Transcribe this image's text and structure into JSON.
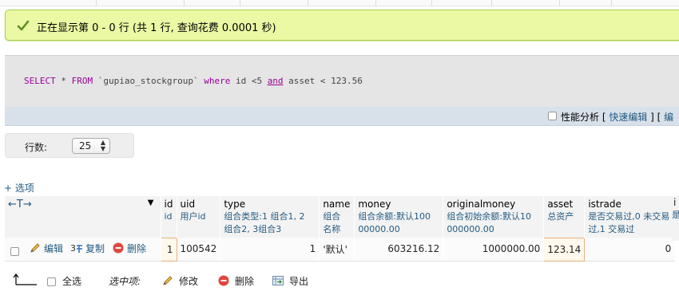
{
  "success": {
    "message": "正在显示第 0 - 0 行 (共 1 行, 查询花费 0.0001 秒)"
  },
  "sql": {
    "select": "SELECT",
    "star": " * ",
    "from": "FROM",
    "table": " `gupiao_stockgroup` ",
    "where": "where",
    "cond1": " id <5 ",
    "and": "and",
    "cond2": " asset < ",
    "value": "123.56"
  },
  "toolbar": {
    "profiling": "性能分析",
    "bracket_open": "[ ",
    "inline_edit": "快速编辑",
    "separator": " ] [ ",
    "edit_cut": "编"
  },
  "rows_control": {
    "label": "行数:",
    "value": "25"
  },
  "options_link": "+ 选项",
  "table": {
    "arrows": "←T→",
    "columns": [
      {
        "name": "id",
        "comment": "id"
      },
      {
        "name": "uid",
        "comment": "用户id"
      },
      {
        "name": "type",
        "comment": "组合类型:1 组合1, 2 组合2, 3组合3"
      },
      {
        "name": "name",
        "comment": "组合名称"
      },
      {
        "name": "money",
        "comment": "组合余额:默认10000000.00"
      },
      {
        "name": "originalmoney",
        "comment": "组合初始余额:默认10000000.00"
      },
      {
        "name": "asset",
        "comment": "总资产"
      },
      {
        "name": "istrade",
        "comment": "是否交易过,0 未交易过,1 交易过"
      },
      {
        "name": "i",
        "comment": "是"
      }
    ],
    "row_actions": {
      "edit": "编辑",
      "copy": "复制",
      "delete": "删除"
    },
    "rows": [
      {
        "id": "1",
        "uid": "100542",
        "type": "1",
        "name": "'默认'",
        "money": "603216.12",
        "originalmoney": "1000000.00",
        "asset": "123.14",
        "istrade": "0"
      }
    ]
  },
  "footer": {
    "select_all": "全选",
    "selected_label": "选中项:",
    "edit": "修改",
    "delete": "删除",
    "export": "导出"
  }
}
